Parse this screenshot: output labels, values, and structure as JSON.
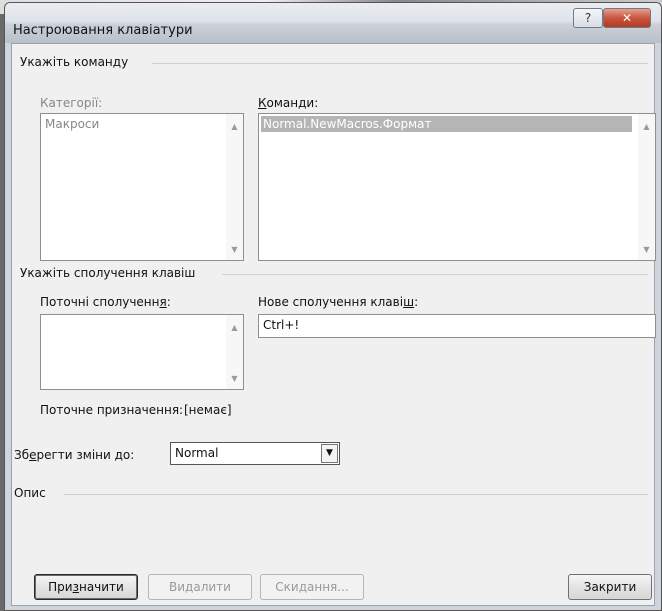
{
  "window": {
    "title": "Настроювання клавіатури",
    "help_glyph": "?",
    "close_glyph": "✕"
  },
  "command_group": {
    "title": "Укажіть команду",
    "categories_label": "Категорії:",
    "categories": [
      "Макроси"
    ],
    "commands_label_prefix": "",
    "commands_label_accel": "К",
    "commands_label_rest": "оманди:",
    "commands": [
      "Normal.NewMacros.Формат"
    ]
  },
  "shortcut_group": {
    "title": "Укажіть сполучення клавіш",
    "current_label_prefix": "Поточні сполученн",
    "current_label_accel": "я",
    "current_label_rest": ":",
    "current_items": [],
    "new_label_prefix": "Нове сполучення клаві",
    "new_label_accel": "ш",
    "new_label_rest": ":",
    "new_value": "Ctrl+!",
    "assignment_label": "Поточне призначення:",
    "assignment_value": "[немає]"
  },
  "save": {
    "label_prefix": "Зб",
    "label_accel": "е",
    "label_rest": "регти зміни до:",
    "selected": "Normal"
  },
  "description": {
    "title": "Опис"
  },
  "buttons": {
    "assign_prefix": "При",
    "assign_accel": "з",
    "assign_rest": "начити",
    "remove": "Видалити",
    "reset": "Скидання...",
    "close": "Закрити"
  },
  "scroll": {
    "up_glyph": "▲",
    "down_glyph": "▼",
    "combo_glyph": "▼"
  }
}
